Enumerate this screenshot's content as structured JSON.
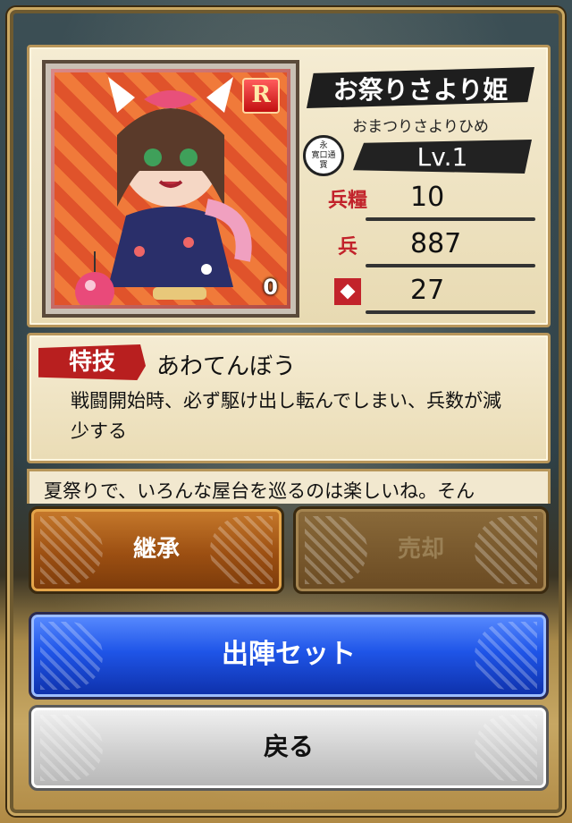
{
  "card": {
    "name": "お祭りさより姫",
    "reading": "おまつりさよりひめ",
    "rarity": "R",
    "count": "0",
    "crest_text": "永\n寛口通\n寳",
    "level": "Lv.1",
    "stats": [
      {
        "icon": "provisions-icon",
        "icon_text": "兵糧",
        "value": "10"
      },
      {
        "icon": "soldiers-icon",
        "icon_text": "兵",
        "value": "887"
      },
      {
        "icon": "shuriken-icon",
        "icon_text": "",
        "value": "27"
      }
    ]
  },
  "skill": {
    "tag": "特技",
    "name": "あわてんぼう",
    "description": "戦闘開始時、必ず駆け出し転んでしまい、兵数が減少する"
  },
  "flavor": {
    "text": "夏祭りで、いろんな屋台を巡るのは楽しいね。そん"
  },
  "buttons": {
    "inherit": "継承",
    "sell": "売却",
    "deploy": "出陣セット",
    "back": "戻る"
  },
  "colors": {
    "inherit": "#9c4f12",
    "sell": "#6a4a22",
    "deploy": "#1f55e8",
    "back": "#cfcfcf",
    "accent_red": "#c2232b"
  }
}
